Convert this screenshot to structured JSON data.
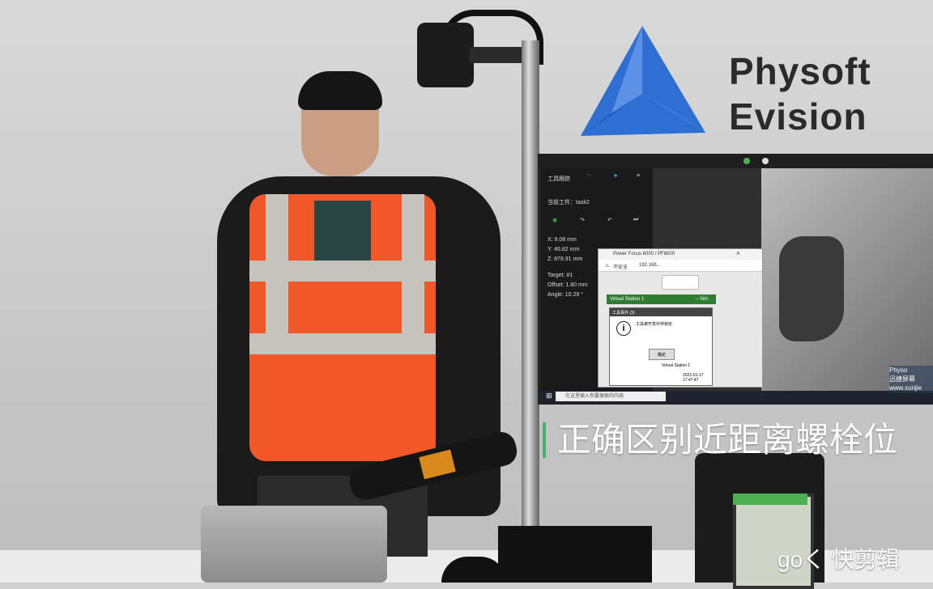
{
  "logo": {
    "line1": "Physoft",
    "line2": "Evision",
    "color": "#2b2b2b",
    "accent": "#2f6fd4"
  },
  "caption": {
    "text": "正确区别近距离螺栓位",
    "accent": "#3fb56b"
  },
  "watermark": {
    "text": "ɡoく 快剪辑"
  },
  "screen": {
    "side_panel": {
      "title": "工具跟踪",
      "task": "当前工件：task2",
      "x": "X: 9.08 mm",
      "y": "Y: 46.82 mm",
      "z": "Z: 878.91 mm",
      "target": "Target: #1",
      "offset": "Offset: 1.80 mm",
      "angle": "Angle: 10.29 °"
    },
    "browser": {
      "tab": "Power Focus 6000 / PF6000",
      "security": "不安全",
      "url": "192.168...",
      "station": "Virtual Station 1",
      "torque": "-- Nm"
    },
    "dialog": {
      "title": "工具事件 (3)",
      "message": "工具被开发伙伴锁定",
      "ok": "确定",
      "station_label": "Virtual Station 1",
      "time": "2021-01-17 17:47:47"
    },
    "taskbar": {
      "search_placeholder": "在这里输入你要搜索的内容"
    },
    "wm_small": {
      "line1": "Physo",
      "line2": "迅捷屏幕",
      "line3": "www.xunjie"
    }
  }
}
